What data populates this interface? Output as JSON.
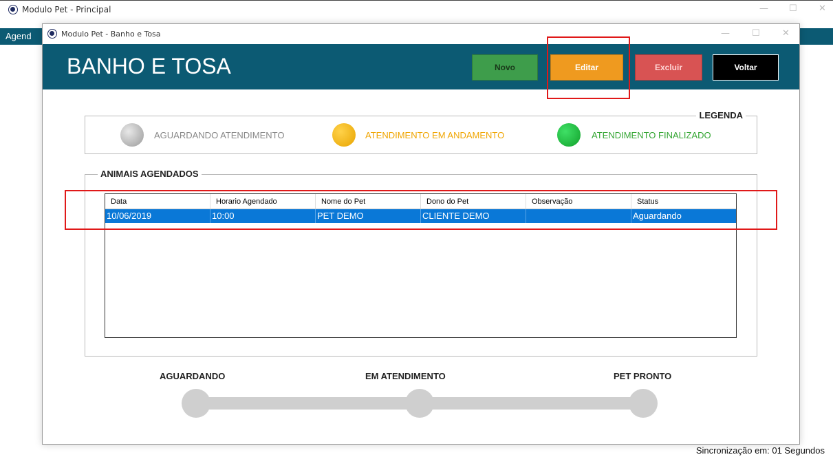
{
  "main": {
    "title": "Modulo Pet - Principal",
    "menu_text": "Agend"
  },
  "child": {
    "title": "Modulo Pet - Banho e Tosa",
    "header_title": "BANHO E TOSA",
    "buttons": {
      "novo": "Novo",
      "editar": "Editar",
      "excluir": "Excluir",
      "voltar": "Voltar"
    },
    "legend": {
      "label": "LEGENDA",
      "items": [
        {
          "text": "AGUARDANDO ATENDIMENTO",
          "color": "#9a9a9a"
        },
        {
          "text": "ATENDIMENTO EM ANDAMENTO",
          "color": "#f0a500"
        },
        {
          "text": "ATENDIMENTO FINALIZADO",
          "color": "#33a532"
        }
      ]
    },
    "scheduled": {
      "label": "ANIMAIS AGENDADOS",
      "columns": [
        "Data",
        "Horario Agendado",
        "Nome do Pet",
        "Dono do Pet",
        "Observação",
        "Status"
      ],
      "rows": [
        [
          "10/06/2019",
          "10:00",
          "PET DEMO",
          "CLIENTE DEMO",
          "",
          "Aguardando"
        ]
      ]
    },
    "progress": {
      "steps": [
        "AGUARDANDO",
        "EM ATENDIMENTO",
        "PET PRONTO"
      ]
    }
  },
  "status_bar": {
    "sync": "Sincronização em: 01 Segundos"
  },
  "colors": {
    "header_bg": "#0c5a73",
    "selected_row": "#0a78d7",
    "highlight": "#e01919"
  }
}
